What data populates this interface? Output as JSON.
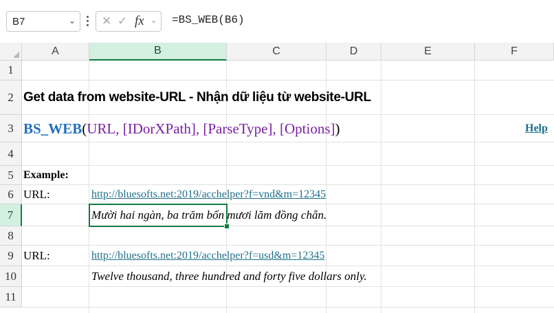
{
  "formula_bar": {
    "name_box": "B7",
    "name_box_chevron": "⌄",
    "cancel_icon": "✕",
    "enter_icon": "✓",
    "fx_label": "fx",
    "fx_chevron": "⌄",
    "formula": "=BS_WEB(B6)"
  },
  "columns": [
    "A",
    "B",
    "C",
    "D",
    "E",
    "F"
  ],
  "rows": [
    "1",
    "2",
    "3",
    "4",
    "5",
    "6",
    "7",
    "8",
    "9",
    "10",
    "11"
  ],
  "selected": {
    "column": "B",
    "row": "7"
  },
  "cells": {
    "a2": "Get data from website-URL - Nhận dữ liệu từ website-URL",
    "a3_fn": "BS_WEB",
    "a3_open": "(",
    "a3_args": "URL, [IDorXPath], [ParseType], [Options]",
    "a3_close": ")",
    "help": "Help",
    "a5": "Example:",
    "a6": "URL:",
    "b6": "http://bluesofts.net:2019/acchelper?f=vnd&m=12345",
    "b7": "Mười hai ngàn, ba trăm bốn mươi lăm đồng chẵn.",
    "a9": "URL:",
    "b9": "http://bluesofts.net:2019/acchelper?f=usd&m=12345",
    "b10": "Twelve thousand, three hundred and forty five dollars only."
  },
  "colors": {
    "accent_green": "#107c41",
    "function_blue": "#1f6fbf",
    "argument_purple": "#7a1fa2",
    "link_teal": "#1f6f8b"
  }
}
